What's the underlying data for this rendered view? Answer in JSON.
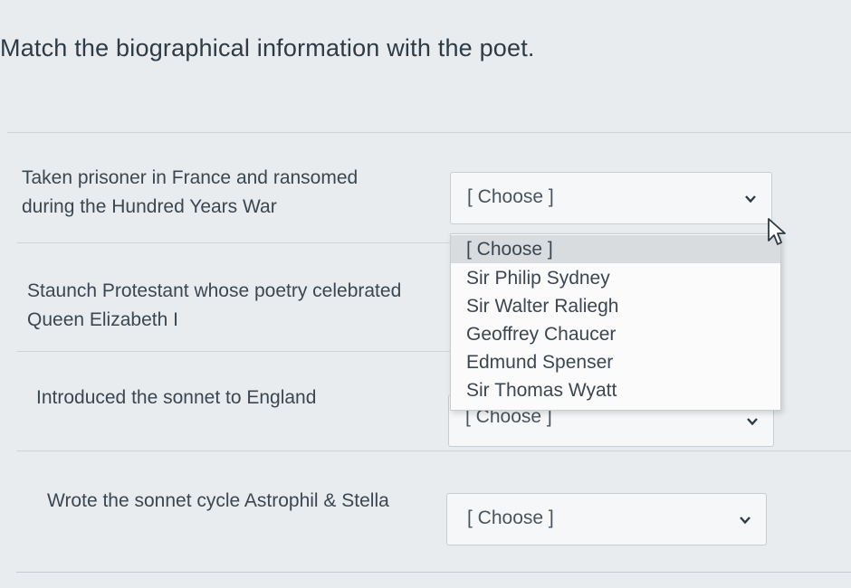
{
  "question": {
    "title": "Match the biographical information with the poet."
  },
  "rows": [
    {
      "prompt_lines": [
        "Taken prisoner in France and ransomed",
        "during the Hundred Years War"
      ],
      "selected": "[ Choose ]"
    },
    {
      "prompt_lines": [
        "Staunch Protestant whose poetry celebrated",
        "Queen Elizabeth I"
      ],
      "selected": "[ Choose ]"
    },
    {
      "prompt_lines": [
        "Introduced the sonnet to England"
      ],
      "selected": "[ Choose ]"
    },
    {
      "prompt_lines": [
        "Wrote the sonnet cycle Astrophil & Stella"
      ],
      "selected": "[ Choose ]"
    }
  ],
  "dropdown": {
    "open_for_row": 1,
    "highlighted_index": 0,
    "options": [
      "[ Choose ]",
      "Sir Philip Sydney",
      "Sir Walter Raliegh",
      "Geoffrey Chaucer",
      "Edmund Spenser",
      "Sir Thomas Wyatt"
    ]
  },
  "icons": {
    "select_chevron": "chevron-down-icon",
    "cursor": "mouse-pointer-icon"
  },
  "colors": {
    "background": "#e9ecee",
    "text": "#2d3b45",
    "highlight": "#d9dcdf"
  }
}
